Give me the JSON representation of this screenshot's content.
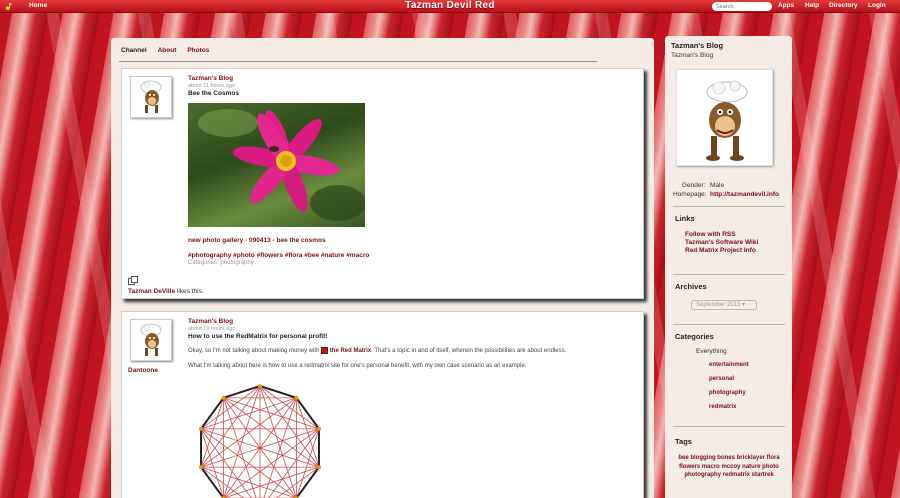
{
  "topnav": {
    "home": "Home",
    "site_title": "Tazman Devil Red",
    "search_placeholder": "Search",
    "apps": "Apps",
    "help": "Help",
    "directory": "Directory",
    "login": "Login"
  },
  "tabs": {
    "channel": "Channel",
    "about": "About",
    "photos": "Photos"
  },
  "posts": [
    {
      "author": "Tazman's Blog",
      "time": "about 11 hours ago",
      "title": "Bee the Cosmos",
      "link": "new photo gallery - 090413 - bee the cosmos",
      "hashtags": "#photography #photo #flowers #flora #bee #nature #macro",
      "categories": "Categories: photography",
      "liker": "Tazman DeVille",
      "likes_text": " likes this."
    },
    {
      "author": "Tazman's Blog",
      "time": "about 19 hours ago",
      "title": "How to use the RedMatrix for personal profit!",
      "under_avatar": "Dantoone",
      "para1_start": "Okay, so I'm not talking about making money with ",
      "para1_link": "the Red Matrix",
      "para1_end": ". That's a topic in and of itself, wherein the possibilities are about endless.",
      "para2": "What I'm talking about here is how to use a redmatrix site for one's personal benefit, with my own case scenario as an example."
    }
  ],
  "sidebar": {
    "blog_title": "Tazman's Blog",
    "blog_sub": "Tazman's Blog",
    "gender_label": "Gender:",
    "gender_value": "Male",
    "homepage_label": "Homepage:",
    "homepage_value": "http://tazmandevil.info",
    "links_title": "Links",
    "links": [
      "Follow with RSS",
      "Tazman's Software Wiki",
      "Red Matrix Project Info"
    ],
    "archives_title": "Archives",
    "archive_selected": "September 2013",
    "categories_title": "Categories",
    "everything": "Everything",
    "categories": [
      "entertainment",
      "personal",
      "photography",
      "redmatrix"
    ],
    "tags_title": "Tags",
    "tags": "bee blogging bones bricklayer flora flowers macro mccoy nature photo photography redmatrix startrek"
  },
  "colors": {
    "accent": "#7a1015",
    "nav_red": "#c0141e",
    "panel_bg": "#f6ece6"
  }
}
